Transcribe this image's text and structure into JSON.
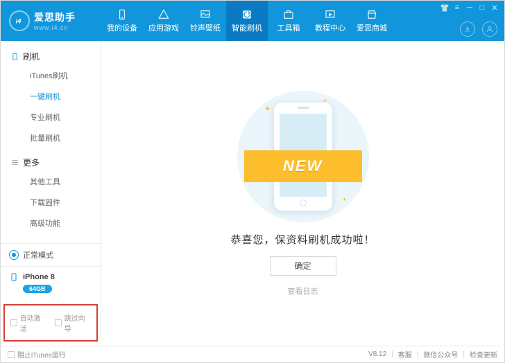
{
  "app": {
    "title": "爱思助手",
    "subtitle": "www.i4.cn",
    "logo_label": "i4"
  },
  "nav": [
    {
      "id": "my-device",
      "label": "我的设备"
    },
    {
      "id": "app-games",
      "label": "应用游戏"
    },
    {
      "id": "ringtone",
      "label": "铃声壁纸"
    },
    {
      "id": "smart-flash",
      "label": "智能刷机"
    },
    {
      "id": "toolbox",
      "label": "工具箱"
    },
    {
      "id": "tutorial",
      "label": "教程中心"
    },
    {
      "id": "mall",
      "label": "爱思商城"
    }
  ],
  "nav_active_index": 3,
  "sidebar": {
    "groups": [
      {
        "id": "flash",
        "label": "刷机",
        "icon": "phone-rect-icon",
        "items": [
          {
            "id": "itunes-flash",
            "label": "iTunes刷机"
          },
          {
            "id": "one-click-flash",
            "label": "一键刷机"
          },
          {
            "id": "pro-flash",
            "label": "专业刷机"
          },
          {
            "id": "batch-flash",
            "label": "批量刷机"
          }
        ]
      },
      {
        "id": "more",
        "label": "更多",
        "icon": "hamburger-icon",
        "items": [
          {
            "id": "other-tools",
            "label": "其他工具"
          },
          {
            "id": "download-fw",
            "label": "下载固件"
          },
          {
            "id": "advanced",
            "label": "高级功能"
          }
        ]
      }
    ],
    "active_item": "one-click-flash",
    "status_label": "正常模式",
    "device": {
      "name": "iPhone 8",
      "storage": "64GB"
    },
    "checks": [
      {
        "id": "auto-activate",
        "label": "自动激活"
      },
      {
        "id": "skip-guide",
        "label": "跳过向导"
      }
    ]
  },
  "content": {
    "ribbon": "NEW",
    "success_msg": "恭喜您，保资料刷机成功啦！",
    "ok_label": "确定",
    "log_link": "查看日志"
  },
  "footer": {
    "block_itunes": "阻止iTunes运行",
    "version": "V8.12",
    "links": [
      {
        "id": "support",
        "label": "客服"
      },
      {
        "id": "wechat",
        "label": "微信公众号"
      },
      {
        "id": "update",
        "label": "检查更新"
      }
    ]
  }
}
